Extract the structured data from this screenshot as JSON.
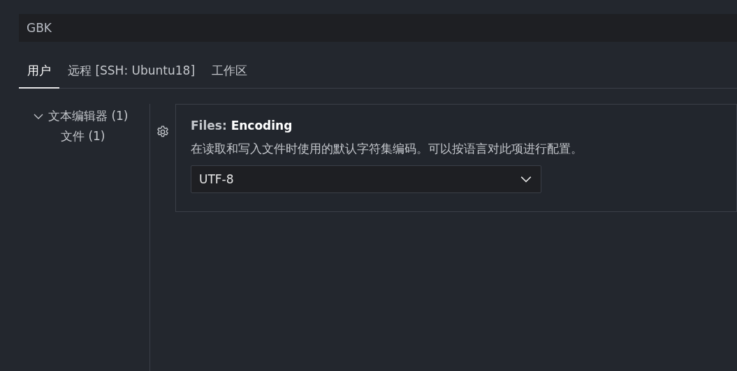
{
  "search": {
    "value": "GBK"
  },
  "tabs": [
    {
      "label": "用户",
      "selected": true
    },
    {
      "label": "远程 [SSH: Ubuntu18]",
      "selected": false
    },
    {
      "label": "工作区",
      "selected": false
    }
  ],
  "tree": [
    {
      "label": "文本编辑器 (1)",
      "expanded": true,
      "children": [
        {
          "label": "文件 (1)"
        }
      ]
    }
  ],
  "setting": {
    "category": "Files:",
    "title": "Encoding",
    "description": "在读取和写入文件时使用的默认字符集编码。可以按语言对此项进行配置。",
    "dropdown": {
      "value": "UTF-8"
    }
  }
}
